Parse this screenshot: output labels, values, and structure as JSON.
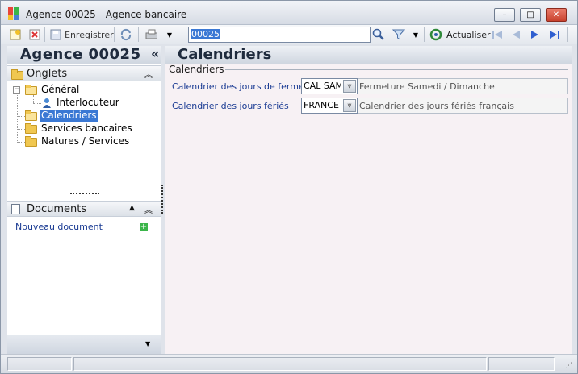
{
  "window": {
    "title": "Agence 00025  -  Agence bancaire",
    "controls": {
      "minimize": "–",
      "maximize": "□",
      "close": "✕"
    }
  },
  "toolbar": {
    "save_label": "Enregistrer",
    "search_value": "00025",
    "refresh_label": "Actualiser"
  },
  "left": {
    "header_title": "Agence 00025",
    "collapse_glyph": "«",
    "onglets_label": "Onglets",
    "tree": {
      "general": "Général",
      "interlocuteur": "Interlocuteur",
      "calendriers": "Calendriers",
      "services": "Services bancaires",
      "natures": "Natures / Services"
    },
    "documents_label": "Documents",
    "new_document": "Nouveau document"
  },
  "main": {
    "title": "Calendriers",
    "group_title": "Calendriers",
    "fields": [
      {
        "label": "Calendrier des jours de fermeture",
        "code": "CAL SAM",
        "description": "Fermeture Samedi / Dimanche"
      },
      {
        "label": "Calendrier des jours fériés",
        "code": "FRANCE",
        "description": "Calendrier des jours fériés français"
      }
    ]
  },
  "colors": {
    "selection": "#3a78d4",
    "link": "#1a3b93",
    "content_bg": "#f7f1f4"
  }
}
